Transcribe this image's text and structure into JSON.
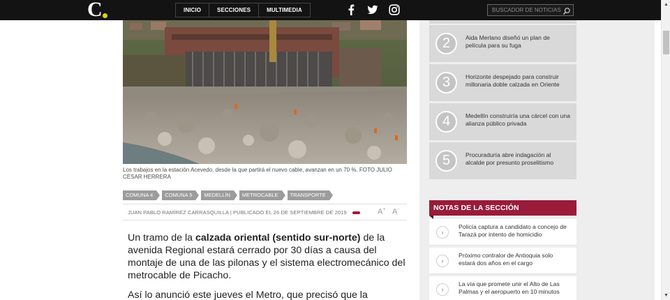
{
  "header": {
    "logo_letter": "C",
    "nav": [
      "INICIO",
      "SECCIONES",
      "MULTIMEDIA"
    ],
    "social_icons": [
      "facebook-icon",
      "twitter-icon",
      "instagram-icon"
    ],
    "search_placeholder": "BUSCADOR DE NOTICIAS",
    "accent_yellow": "#e3d400"
  },
  "article": {
    "caption": "Los trabajos en la estación Acevedo, desde la que partirá el nuevo cable, avanzan en un 70 %. FOTO JULIO CÉSAR HERRERA",
    "tags": [
      "COMUNA 4",
      "COMUNA 5",
      "MEDELLÍN",
      "METROCABLE",
      "TRANSPORTE"
    ],
    "byline": "JUAN PABLO RAMÍREZ CARRASQUILLA | PUBLICADO EL 26 DE SEPTIEMBRE DE 2019",
    "font_increase": "A",
    "font_increase_sign": "+",
    "font_decrease": "A",
    "font_decrease_sign": "-",
    "p1_start": "Un tramo de la ",
    "p1_bold": "calzada oriental (sentido sur-norte)",
    "p1_end": " de la avenida Regional estará cerrado por 30 días a causa del montaje de una de las pilonas y el sistema electromecánico del metrocable de Picacho.",
    "p2": "Así lo anunció este jueves el Metro, que precisó que la"
  },
  "sidebar": {
    "ranked": [
      {
        "num": "2",
        "title": "Aida Merlano diseñó un plan de película para su fuga"
      },
      {
        "num": "3",
        "title": "Horizonte despejado para construir millonaria doble calzada en Oriente"
      },
      {
        "num": "4",
        "title": "Medellín construiría una cárcel con una alianza público privada"
      },
      {
        "num": "5",
        "title": "Procuraduría abre indagación al alcalde por presunto proselitismo"
      }
    ],
    "section_title": "NOTAS DE LA SECCIÓN",
    "notes": [
      {
        "title": "Policía captura a candidato a concejo de Tarazá por intento de homicidio"
      },
      {
        "title": "Próximo contralor de Antioquia solo estará dos años en el cargo"
      },
      {
        "title": "La vía que promete unir el Alto de Las Palmas y el aeropuerto en 10 minutos"
      }
    ],
    "accent_wine": "#9a1b3a"
  }
}
